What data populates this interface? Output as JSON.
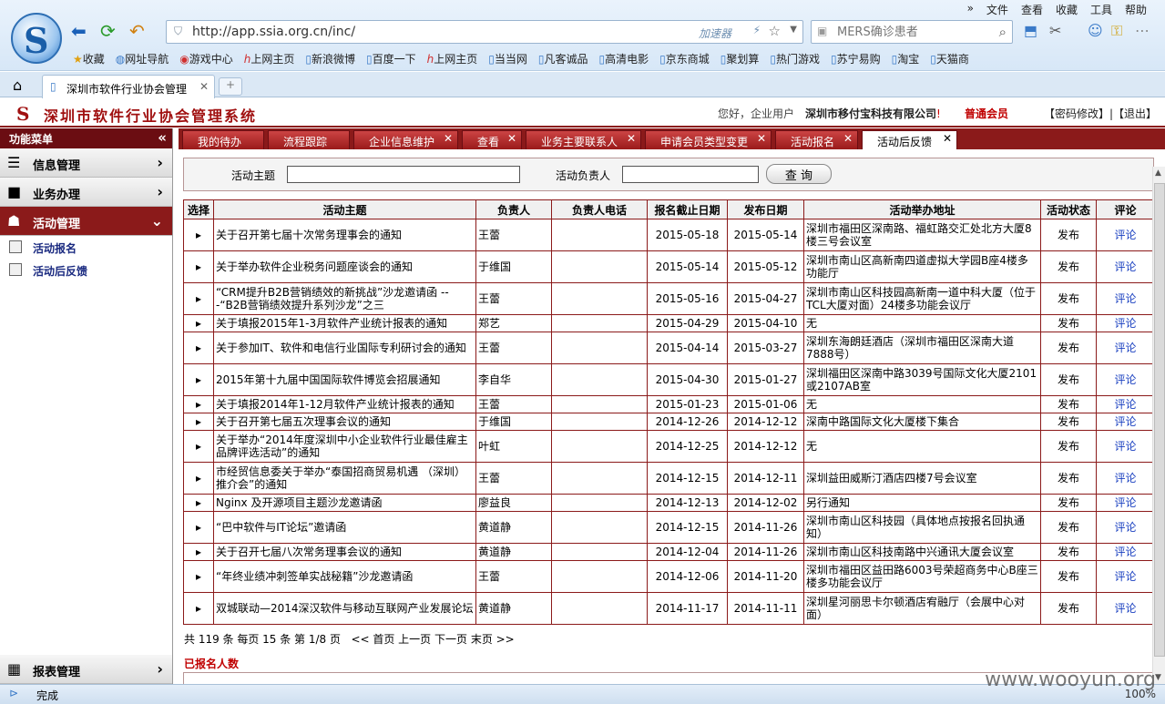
{
  "browser": {
    "menu": [
      "»",
      "文件",
      "查看",
      "收藏",
      "工具",
      "帮助"
    ],
    "address": "http://app.ssia.org.cn/inc/",
    "accelerator": "加速器",
    "search_placeholder": "MERS确诊患者",
    "favorites": [
      "收藏",
      "网址导航",
      "游戏中心",
      "上网主页",
      "新浪微博",
      "百度一下",
      "上网主页",
      "当当网",
      "凡客诚品",
      "高清电影",
      "京东商城",
      "聚划算",
      "热门游戏",
      "苏宁易购",
      "淘宝",
      "天猫商"
    ],
    "tab_title": "深圳市软件行业协会管理",
    "status": "完成",
    "zoom": "100%"
  },
  "header": {
    "title": "深圳市软件行业协会管理系统",
    "greeting": "您好，企业用户",
    "company": "深圳市移付宝科技有限公司",
    "member_level": "普通会员",
    "links": "【密码修改】|【退出】"
  },
  "sidebar": {
    "title": "功能菜单",
    "groups": [
      "信息管理",
      "业务办理",
      "活动管理",
      "报表管理"
    ],
    "sub_items": [
      "活动报名",
      "活动后反馈"
    ]
  },
  "tabs": [
    "我的待办",
    "流程跟踪",
    "企业信息维护",
    "查看",
    "业务主要联系人",
    "申请会员类型变更",
    "活动报名",
    "活动后反馈"
  ],
  "search": {
    "topic_label": "活动主题",
    "owner_label": "活动负责人",
    "query_button": "查 询"
  },
  "table": {
    "headers": [
      "选择",
      "活动主题",
      "负责人",
      "负责人电话",
      "报名截止日期",
      "发布日期",
      "活动举办地址",
      "活动状态",
      "评论"
    ],
    "rows": [
      [
        "关于召开第七届十次常务理事会的通知",
        "王蕾",
        "",
        "2015-05-18",
        "2015-05-14",
        "深圳市福田区深南路、福虹路交汇处北方大厦8楼三号会议室",
        "发布",
        "评论"
      ],
      [
        "关于举办软件企业税务问题座谈会的通知",
        "于维国",
        "",
        "2015-05-14",
        "2015-05-12",
        "深圳市南山区高新南四道虚拟大学园B座4楼多功能厅",
        "发布",
        "评论"
      ],
      [
        "“CRM提升B2B营销绩效的新挑战”沙龙邀请函 ---“B2B营销绩效提升系列沙龙”之三",
        "王蕾",
        "",
        "2015-05-16",
        "2015-04-27",
        "深圳市南山区科技园高新南一道中科大厦（位于TCL大厦对面）24楼多功能会议厅",
        "发布",
        "评论"
      ],
      [
        "关于填报2015年1-3月软件产业统计报表的通知",
        "郑艺",
        "",
        "2015-04-29",
        "2015-04-10",
        "无",
        "发布",
        "评论"
      ],
      [
        "关于参加IT、软件和电信行业国际专利研讨会的通知",
        "王蕾",
        "",
        "2015-04-14",
        "2015-03-27",
        "深圳东海朗廷酒店（深圳市福田区深南大道7888号）",
        "发布",
        "评论"
      ],
      [
        "2015年第十九届中国国际软件博览会招展通知",
        "李自华",
        "",
        "2015-04-30",
        "2015-01-27",
        "深圳福田区深南中路3039号国际文化大厦2101或2107AB室",
        "发布",
        "评论"
      ],
      [
        "关于填报2014年1-12月软件产业统计报表的通知",
        "王蕾",
        "",
        "2015-01-23",
        "2015-01-06",
        "无",
        "发布",
        "评论"
      ],
      [
        "关于召开第七届五次理事会议的通知",
        "于维国",
        "",
        "2014-12-26",
        "2014-12-12",
        "深南中路国际文化大厦楼下集合",
        "发布",
        "评论"
      ],
      [
        "关于举办“2014年度深圳中小企业软件行业最佳雇主品牌评选活动”的通知",
        "叶虹",
        "",
        "2014-12-25",
        "2014-12-12",
        "无",
        "发布",
        "评论"
      ],
      [
        "市经贸信息委关于举办“泰国招商贸易机遇 （深圳）推介会”的通知",
        "王蕾",
        "",
        "2014-12-15",
        "2014-12-11",
        "深圳益田威斯汀酒店四楼7号会议室",
        "发布",
        "评论"
      ],
      [
        "Nginx 及开源项目主题沙龙邀请函",
        "廖益良",
        "",
        "2014-12-13",
        "2014-12-02",
        "另行通知",
        "发布",
        "评论"
      ],
      [
        "“巴中软件与IT论坛”邀请函",
        "黄道静",
        "",
        "2014-12-15",
        "2014-11-26",
        "深圳市南山区科技园（具体地点按报名回执通知）",
        "发布",
        "评论"
      ],
      [
        "关于召开七届八次常务理事会议的通知",
        "黄道静",
        "",
        "2014-12-04",
        "2014-11-26",
        "深圳市南山区科技南路中兴通讯大厦会议室",
        "发布",
        "评论"
      ],
      [
        "“年终业绩冲刺签单实战秘籍”沙龙邀请函",
        "王蕾",
        "",
        "2014-12-06",
        "2014-11-20",
        "深圳市福田区益田路6003号荣超商务中心B座三楼多功能会议厅",
        "发布",
        "评论"
      ],
      [
        "双城联动—2014深汉软件与移动互联网产业发展论坛",
        "黄道静",
        "",
        "2014-11-17",
        "2014-11-11",
        "深圳星河丽思卡尔顿酒店宥融厅（会展中心对面）",
        "发布",
        "评论"
      ]
    ]
  },
  "pager": "共 119 条 每页 15 条 第 1/8 页   << 首页 上一页 下一页 末页 >>",
  "signed_up_label": "已报名人数",
  "watermark": "www.wooyun.org"
}
